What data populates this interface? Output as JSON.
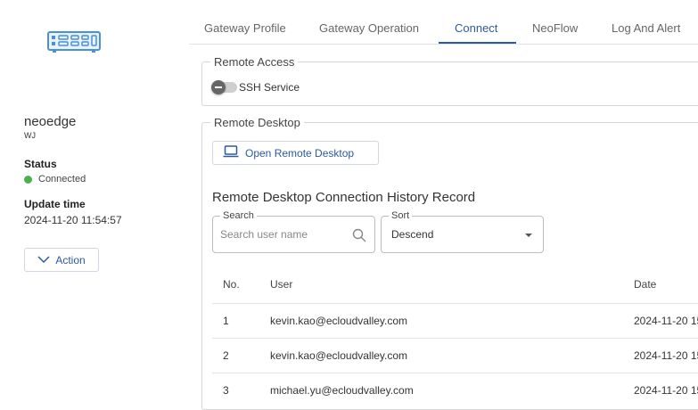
{
  "device": {
    "icon": "gateway-device-icon",
    "name": "neoedge",
    "subtitle": "WJ",
    "status_label": "Status",
    "status_value": "Connected",
    "status_color": "#4caf50",
    "update_label": "Update time",
    "update_value": "2024-11-20 11:54:57",
    "action_label": "Action"
  },
  "tabs": [
    {
      "label": "Gateway Profile"
    },
    {
      "label": "Gateway Operation"
    },
    {
      "label": "Connect",
      "active": true
    },
    {
      "label": "NeoFlow"
    },
    {
      "label": "Log And Alert"
    }
  ],
  "remote_access": {
    "title": "Remote Access",
    "ssh_label": "SSH Service",
    "ssh_enabled": false
  },
  "remote_desktop": {
    "title": "Remote Desktop",
    "open_button": "Open Remote Desktop",
    "history_title": "Remote Desktop Connection History Record",
    "search": {
      "label": "Search",
      "placeholder": "Search user name"
    },
    "sort": {
      "label": "Sort",
      "value": "Descend"
    },
    "table": {
      "headers": {
        "no": "No.",
        "user": "User",
        "date": "Date"
      },
      "rows": [
        {
          "no": "1",
          "user": "kevin.kao@ecloudvalley.com",
          "date": "2024-11-20 15"
        },
        {
          "no": "2",
          "user": "kevin.kao@ecloudvalley.com",
          "date": "2024-11-20 15"
        },
        {
          "no": "3",
          "user": "michael.yu@ecloudvalley.com",
          "date": "2024-11-20 15"
        }
      ]
    }
  },
  "colors": {
    "accent": "#2b5aa0",
    "device_icon": "#4a90d9"
  }
}
